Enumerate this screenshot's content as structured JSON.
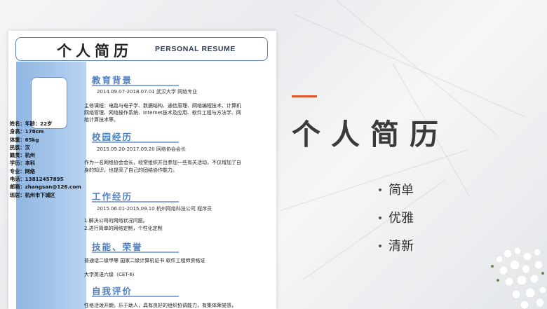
{
  "resume": {
    "title_cn": "个人简历",
    "title_en": "PERSONAL RESUME",
    "sidebar": {
      "lines": [
        "姓名：年龄：22岁",
        "身高：178cm",
        "体重：65kg",
        "民族：汉",
        "籍贯：杭州",
        "学历：本科",
        "专业：网络",
        "电话：13812457895",
        "邮箱：zhangsan@126.com",
        "现居：杭州市下城区"
      ]
    },
    "sections": {
      "education": {
        "title": "教育背景",
        "line1": "2014.09.07-2018.07.01    武汉大学          网络专业",
        "desc1": "主修课程：电路与电子学、数据结构、通信原理、网络编程技术、计算机",
        "desc2": "网络管理、网络操作系统、Internet技术及应用、软件工程与方法学、网",
        "desc3": "络计算技术等。"
      },
      "campus": {
        "title": "校园经历",
        "line1": "2015.09.20-2017.09.20          网络协会会长",
        "desc1": "作为一名网络协会会长，经常组织并且参加一些有关活动，不仅增加了自",
        "desc2": "身的知识，也提高了自己的团结协作能力。"
      },
      "work": {
        "title": "工作经历",
        "line1": "2015.06.01-2015.09.10        杭州网络科技公司          程序员",
        "desc1": "1.解决公司的网络状况问题。",
        "desc2": "2.进行简单的网络定制，个性化定制"
      },
      "skills": {
        "title": "技能、荣誉",
        "line1": "普通话二级甲等    国家二级计算机证书  软件工程师资格证",
        "line2": "大学英语六级（CET-6）"
      },
      "self": {
        "title": "自我评价",
        "line1": "性格活泼开朗，乐于助人，具有良好的组织协调能力，有集体荣誉感，"
      }
    }
  },
  "slide": {
    "heading": "个人简历",
    "bullets": [
      "简单",
      "优雅",
      "清新"
    ],
    "accent_color": "#e2562a",
    "sidebar_color": "#8fb6e3"
  }
}
